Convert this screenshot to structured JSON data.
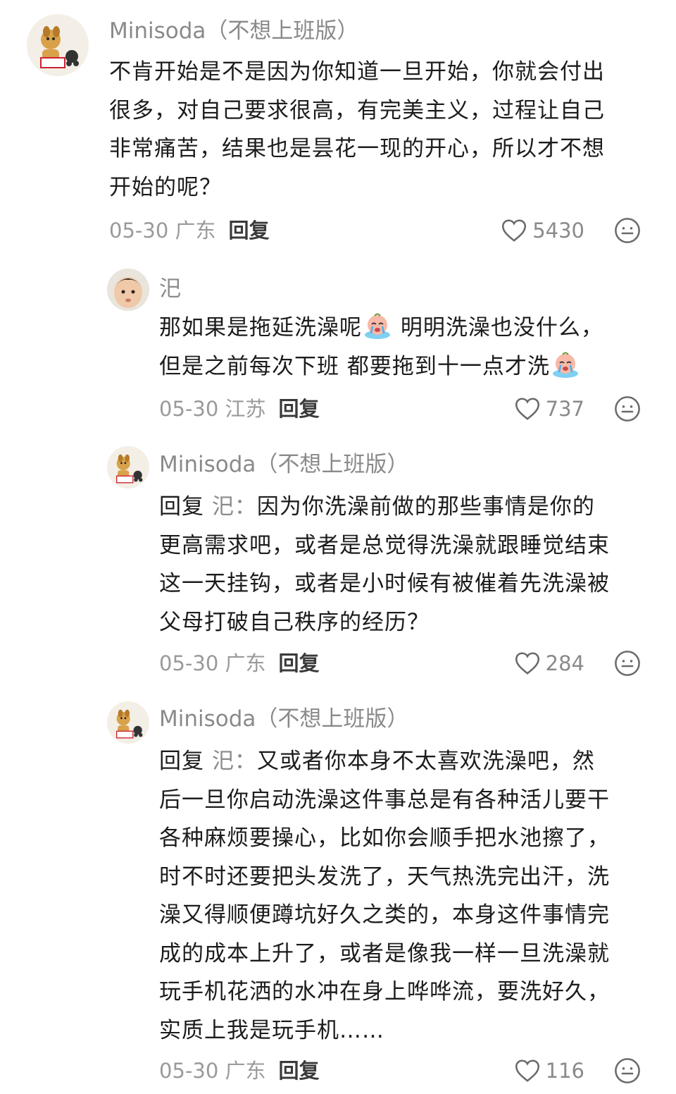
{
  "comments": [
    {
      "username": "Minisoda（不想上班版）",
      "avatar": "dog-cartoon-avatar",
      "lines": [
        "不肯开始是不是因为你知道一旦开始，你就会付出",
        "很多，对自己要求很高，有完美主义，过程让自己",
        "非常痛苦，结果也是昙花一现的开心，所以才不想",
        "开始的呢？"
      ],
      "date_location": "05-30 广东",
      "reply_label": "回复",
      "likes": "5430"
    },
    {
      "username": "汜",
      "avatar": "baby-face-avatar",
      "lines": [
        "那如果是拖延洗澡呢",
        " 明明洗澡也没什么，",
        "但是之前每次下班 都要拖到十一点才洗"
      ],
      "date_location": "05-30 江苏",
      "reply_label": "回复",
      "likes": "737"
    },
    {
      "username": "Minisoda（不想上班版）",
      "avatar": "dog-cartoon-avatar",
      "reply_prefix": "回复",
      "reply_target": "汜：",
      "lines": [
        "因为你洗澡前做的那些事情是你的",
        "更高需求吧，或者是总觉得洗澡就跟睡觉结束",
        "这一天挂钩，或者是小时候有被催着先洗澡被",
        "父母打破自己秩序的经历？"
      ],
      "date_location": "05-30 广东",
      "reply_label": "回复",
      "likes": "284"
    },
    {
      "username": "Minisoda（不想上班版）",
      "avatar": "dog-cartoon-avatar",
      "reply_prefix": "回复",
      "reply_target": "汜：",
      "lines": [
        "又或者你本身不太喜欢洗澡吧，然",
        "后一旦你启动洗澡这件事总是有各种活儿要干",
        "各种麻烦要操心，比如你会顺手把水池擦了，",
        "时不时还要把头发洗了，天气热洗完出汗，洗",
        "澡又得顺便蹲坑好久之类的，本身这件事情完",
        "成的成本上升了，或者是像我一样一旦洗澡就",
        "玩手机花洒的水冲在身上哗哗流，要洗好久，",
        "实质上我是玩手机……"
      ],
      "date_location": "05-30 广东",
      "reply_label": "回复",
      "likes": "116"
    }
  ],
  "icons": {
    "like": "heart-outline-icon",
    "reaction": "smiley-face-icon",
    "emoji": "crying-face-emoji"
  }
}
